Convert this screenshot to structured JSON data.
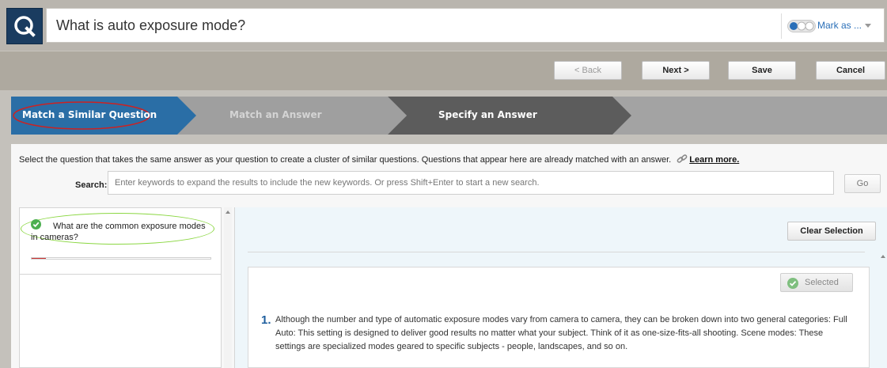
{
  "header": {
    "title": "What is auto exposure mode?",
    "logo_icon": "q-logo-icon",
    "status_icon": "progress-dots-icon",
    "mark_as_label": "Mark as ..."
  },
  "toolbar": {
    "back_label": "< Back",
    "next_label": "Next >",
    "save_label": "Save",
    "cancel_label": "Cancel"
  },
  "steps": [
    {
      "label": "Match a Similar Question",
      "state": "active"
    },
    {
      "label": "Match an Answer",
      "state": "disabled"
    },
    {
      "label": "Specify an Answer",
      "state": "available"
    }
  ],
  "instructions": {
    "text": "Select the question that takes the same answer as your question to create a cluster of similar questions. Questions that appear here are already matched with an answer.",
    "link_label": "Learn more.",
    "link_icon": "link-icon"
  },
  "search": {
    "label": "Search:",
    "placeholder": "Enter keywords to expand the results to include the new keywords. Or press Shift+Enter to start a new search.",
    "value": "",
    "go_label": "Go"
  },
  "results": [
    {
      "text": "What are the common exposure modes in cameras?",
      "matched": true,
      "progress": 0.08
    }
  ],
  "detail": {
    "clear_label": "Clear Selection",
    "selected_label": "Selected",
    "answers": [
      {
        "number": "1.",
        "text": "Although the number and type of automatic exposure modes vary from camera to camera, they can be broken down into two general categories: Full Auto: This setting is designed to deliver good results no matter what your subject. Think of it as one-size-fits-all shooting. Scene modes: These settings are specialized modes geared to specific subjects - people, landscapes, and so on."
      }
    ]
  },
  "colors": {
    "step_active": "#2a6ea6",
    "step_disabled": "#9f9f9f",
    "step_available": "#5c5c5c",
    "accent_blue": "#2a6fb8",
    "annotation_red": "#cc2222",
    "annotation_green": "#8bd742"
  }
}
